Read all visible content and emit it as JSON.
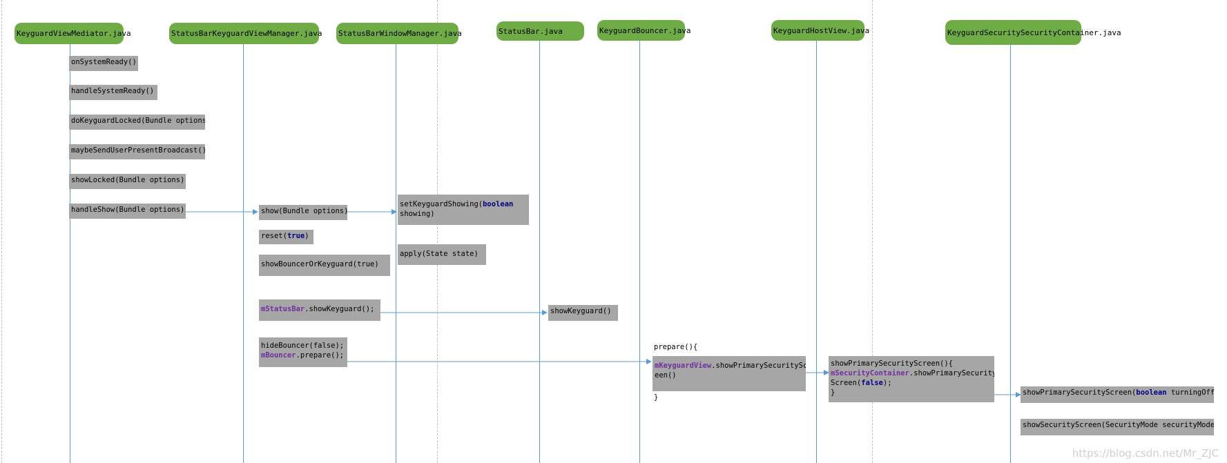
{
  "participants": [
    "KeyguardViewMediator.java",
    "StatusBarKeyguardViewManager.java",
    "StatusBarWindowManager.java",
    "StatusBar.java",
    "KeyguardBouncer.java",
    "KeyguardHostView.java",
    "KeyguardSecuritySecurityContainer.java"
  ],
  "mediator_calls": [
    "onSystemReady()",
    "handleSystemReady()",
    "doKeyguardLocked(Bundle options)",
    "maybeSendUserPresentBroadcast()",
    "showLocked(Bundle options)",
    "handleShow(Bundle options)"
  ],
  "manager_calls": {
    "show": "show(Bundle options)",
    "reset_prefix": "reset(",
    "reset_kw": "true",
    "reset_suffix": ")",
    "show_bouncer": "showBouncerOrKeyguard(true)",
    "status_bar_field": "mStatusBar",
    "status_bar_call": ".showKeyguard();",
    "hide_bouncer": "hideBouncer(false);",
    "bouncer_field": "mBouncer",
    "bouncer_call": ".prepare();"
  },
  "window_manager_calls": {
    "set_showing_prefix": "setKeyguardShowing(",
    "set_showing_kw": "boolean",
    "set_showing_suffix": "showing)",
    "apply": "apply(State state)"
  },
  "status_bar_calls": {
    "show_keyguard": "showKeyguard()"
  },
  "bouncer_calls": {
    "prepare_open": "prepare(){",
    "keyguard_view_field": "mKeyguardView",
    "keyguard_view_call_a": ".showPrimarySecurityScr",
    "keyguard_view_call_b": "een()",
    "close": "}"
  },
  "host_view_calls": {
    "open": "showPrimarySecurityScreen(){",
    "container_field": "mSecurityContainer",
    "container_call": ".showPrimarySecurity",
    "screen_prefix": "Screen(",
    "screen_kw": "false",
    "screen_suffix": ");",
    "close": "}"
  },
  "container_calls": {
    "primary_prefix": "showPrimarySecurityScreen(",
    "primary_kw": "boolean",
    "primary_suffix": " turningOff)",
    "security_screen": "showSecurityScreen(SecurityMode securityMode)"
  },
  "watermark": "https://blog.csdn.net/Mr_ZJC",
  "colors": {
    "header": "#6fac46",
    "box": "#a6a6a6",
    "lifeline": "#5b9bd5",
    "keyword": "#000080",
    "field": "#7030a0"
  }
}
